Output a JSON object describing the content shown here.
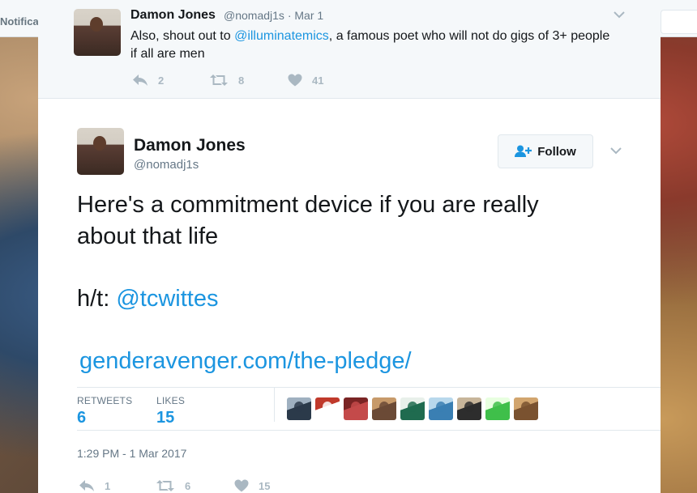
{
  "background": {
    "nav_label": "Notifica"
  },
  "ancestor_tweet": {
    "name": "Damon Jones",
    "handle": "@nomadj1s",
    "date": "· Mar 1",
    "text_pre": "Also, shout out to ",
    "mention": "@illuminatemics",
    "text_post": ", a famous poet who will not do gigs of 3+ people if all are men",
    "reply_count": "2",
    "retweet_count": "8",
    "like_count": "41"
  },
  "main_tweet": {
    "name": "Damon Jones",
    "handle": "@nomadj1s",
    "follow_label": "Follow",
    "text_line1": "Here's a commitment device if you are really",
    "text_line2": "about that life",
    "ht_prefix": "h/t: ",
    "ht_mention": "@tcwittes",
    "link": "genderavenger.com/the-pledge/",
    "retweets_label": "RETWEETS",
    "retweets_value": "6",
    "likes_label": "LIKES",
    "likes_value": "15",
    "timestamp": "1:29 PM - 1 Mar 2017",
    "reply_count": "1",
    "retweet_count": "6",
    "like_count": "15"
  },
  "likers": [
    {
      "icon": "avatar-1",
      "colors": [
        "#2b3a4a",
        "#9fb0c0"
      ]
    },
    {
      "icon": "avatar-2",
      "colors": [
        "#ffffff",
        "#c0392b"
      ]
    },
    {
      "icon": "avatar-3",
      "colors": [
        "#c44a4a",
        "#7a2424"
      ]
    },
    {
      "icon": "avatar-4",
      "colors": [
        "#6b4a36",
        "#c79a6a"
      ]
    },
    {
      "icon": "avatar-5",
      "colors": [
        "#1f6b4f",
        "#e8f0ea"
      ]
    },
    {
      "icon": "avatar-6",
      "colors": [
        "#3a7fb3",
        "#b8d8ec"
      ]
    },
    {
      "icon": "avatar-7",
      "colors": [
        "#2d2d2d",
        "#c7b59a"
      ]
    },
    {
      "icon": "avatar-8",
      "colors": [
        "#3fbf4a",
        "#e8ffe0"
      ]
    },
    {
      "icon": "avatar-9",
      "colors": [
        "#7a5230",
        "#d2a56e"
      ]
    }
  ],
  "colors": {
    "link": "#1b95e0",
    "text": "#14171a",
    "secondary": "#657786",
    "icon_gray": "#aab8c2"
  }
}
